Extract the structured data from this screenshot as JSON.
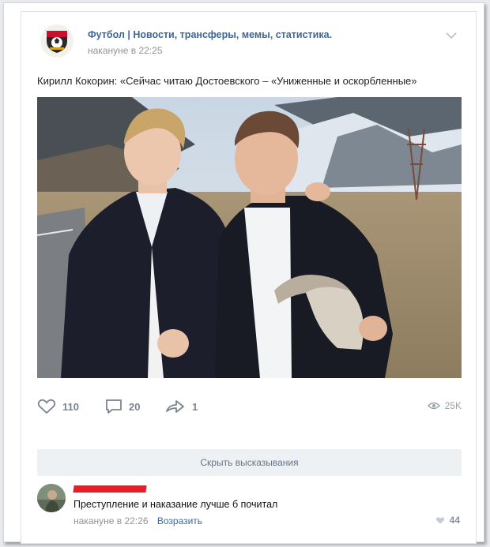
{
  "post": {
    "group_name": "Футбол | Новости, трансферы, мемы, статистика.",
    "time": "накануне в 22:25",
    "text": "Кирилл Кокорин: «Сейчас читаю Достоевского – «Униженные и оскорбленные»"
  },
  "actions": {
    "likes": "110",
    "comments": "20",
    "shares": "1",
    "views": "25K"
  },
  "hide_comments_label": "Скрыть высказывания",
  "comment": {
    "text": "Преступление и наказание лучше б почитал",
    "time": "накануне в 22:26",
    "reply_label": "Возразить",
    "likes": "44"
  },
  "colors": {
    "link": "#3d6799",
    "muted": "#939393",
    "redaction": "#ec1c24"
  }
}
